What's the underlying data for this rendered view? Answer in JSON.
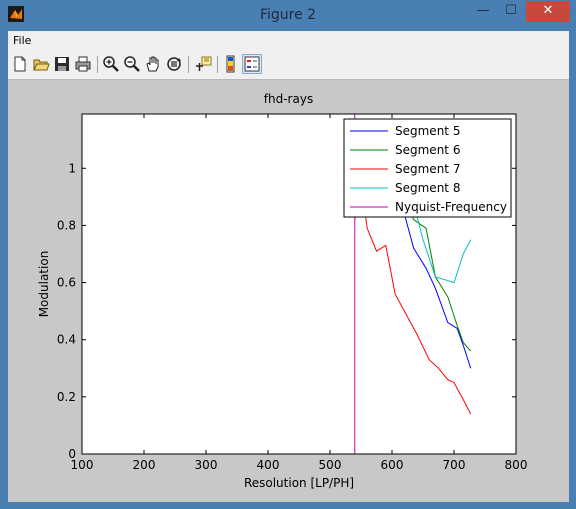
{
  "window": {
    "title": "Figure 2"
  },
  "title_buttons": {
    "minimize": "—",
    "maximize": "☐",
    "close": "✕"
  },
  "menu": {
    "items": [
      "File"
    ]
  },
  "toolbar": {
    "icons": [
      "new-file-icon",
      "open-folder-icon",
      "save-icon",
      "print-icon",
      "zoom-in-icon",
      "zoom-out-icon",
      "pan-hand-icon",
      "rotate-3d-icon",
      "data-cursor-icon",
      "colorbar-icon",
      "legend-icon"
    ]
  },
  "colors": {
    "segment5": "#0000ff",
    "segment6": "#008000",
    "segment7": "#ff0000",
    "segment8": "#00bfbf",
    "nyquist": "#bf00bf"
  },
  "chart_data": {
    "type": "line",
    "title": "fhd-rays",
    "xlabel": "Resolution [LP/PH]",
    "ylabel": "Modulation",
    "xlim": [
      100,
      800
    ],
    "ylim": [
      0,
      1.19
    ],
    "xticks": [
      100,
      200,
      300,
      400,
      500,
      600,
      700,
      800
    ],
    "yticks": [
      0,
      0.2,
      0.4,
      0.6,
      0.8,
      1
    ],
    "ytick_labels": [
      "0",
      "0.2",
      "0.4",
      "0.6",
      "0.8",
      "1"
    ],
    "legend_position": "top-right",
    "series": [
      {
        "name": "Segment 5",
        "x": [
          595,
          615,
          635,
          655,
          670,
          690,
          705,
          715,
          727
        ],
        "y": [
          1.02,
          0.88,
          0.72,
          0.65,
          0.58,
          0.46,
          0.44,
          0.38,
          0.3
        ]
      },
      {
        "name": "Segment 6",
        "x": [
          595,
          615,
          635,
          655,
          670,
          690,
          705,
          715,
          727
        ],
        "y": [
          1.01,
          0.93,
          0.82,
          0.79,
          0.62,
          0.55,
          0.45,
          0.39,
          0.36
        ]
      },
      {
        "name": "Segment 7",
        "x": [
          540,
          550,
          560,
          575,
          590,
          605,
          620,
          640,
          660,
          675,
          690,
          700,
          715,
          727
        ],
        "y": [
          0.82,
          0.95,
          0.79,
          0.71,
          0.73,
          0.56,
          0.5,
          0.42,
          0.33,
          0.3,
          0.26,
          0.25,
          0.19,
          0.14
        ]
      },
      {
        "name": "Segment 8",
        "x": [
          540,
          560,
          580,
          600,
          615,
          630,
          650,
          670,
          685,
          700,
          715,
          727
        ],
        "y": [
          0.98,
          0.9,
          1.01,
          1.0,
          0.95,
          0.92,
          0.75,
          0.62,
          0.61,
          0.6,
          0.7,
          0.75
        ]
      },
      {
        "name": "Nyquist-Frequency",
        "x": [
          540,
          540
        ],
        "y": [
          0,
          1.19
        ]
      }
    ]
  }
}
